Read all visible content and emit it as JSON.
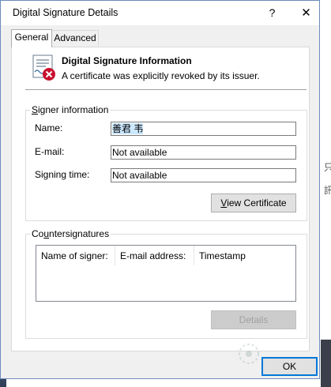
{
  "window": {
    "title": "Digital Signature Details",
    "help_glyph": "?",
    "close_glyph": "✕"
  },
  "tabs": [
    {
      "label": "General",
      "active": true
    },
    {
      "label": "Advanced",
      "active": false
    }
  ],
  "info": {
    "title": "Digital Signature Information",
    "status": "A certificate was explicitly revoked by its issuer.",
    "icon": "certificate-revoked-icon"
  },
  "signer": {
    "group_label": "Signer information",
    "name_label": "Name:",
    "name_value": "善君 韦",
    "email_label": "E-mail:",
    "email_value": "Not available",
    "time_label": "Signing time:",
    "time_value": "Not available",
    "view_certificate_label": "View Certificate"
  },
  "countersignatures": {
    "group_label": "Countersignatures",
    "columns": [
      "Name of signer:",
      "E-mail address:",
      "Timestamp"
    ],
    "details_label": "Details"
  },
  "ok_label": "OK",
  "colors": {
    "accent": "#0078d7",
    "revoked": "#c8102e",
    "selection": "#cce8ff"
  }
}
